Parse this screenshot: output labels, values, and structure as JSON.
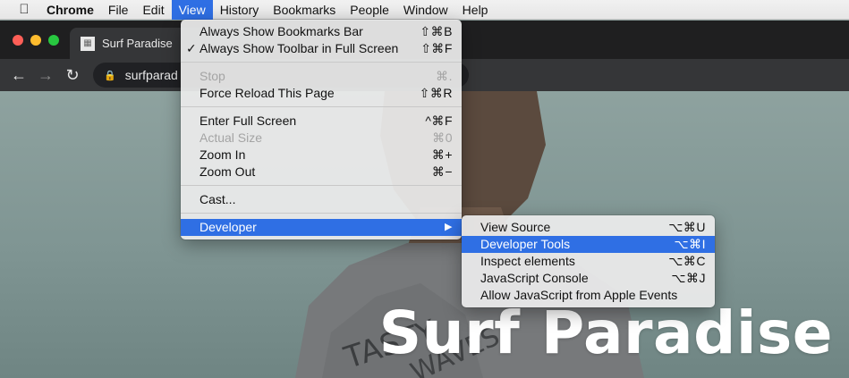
{
  "menubar": {
    "app_name": "Chrome",
    "items": [
      "File",
      "Edit",
      "View",
      "History",
      "Bookmarks",
      "People",
      "Window",
      "Help"
    ],
    "active": "View"
  },
  "browser": {
    "tab_title": "Surf Paradise",
    "url": "surfparad"
  },
  "view_menu": {
    "always_show_bookmarks_bar": {
      "label": "Always Show Bookmarks Bar",
      "shortcut": "⇧⌘B"
    },
    "always_show_toolbar": {
      "label": "Always Show Toolbar in Full Screen",
      "shortcut": "⇧⌘F",
      "checked": true
    },
    "stop": {
      "label": "Stop",
      "shortcut": "⌘.",
      "enabled": false
    },
    "force_reload": {
      "label": "Force Reload This Page",
      "shortcut": "⇧⌘R"
    },
    "enter_full_screen": {
      "label": "Enter Full Screen",
      "shortcut": "^⌘F"
    },
    "actual_size": {
      "label": "Actual Size",
      "shortcut": "⌘0",
      "enabled": false
    },
    "zoom_in": {
      "label": "Zoom In",
      "shortcut": "⌘+"
    },
    "zoom_out": {
      "label": "Zoom Out",
      "shortcut": "⌘−"
    },
    "cast": {
      "label": "Cast..."
    },
    "developer": {
      "label": "Developer",
      "submenu_arrow": "▶"
    }
  },
  "developer_menu": {
    "view_source": {
      "label": "View Source",
      "shortcut": "⌥⌘U"
    },
    "developer_tools": {
      "label": "Developer Tools",
      "shortcut": "⌥⌘I"
    },
    "inspect_elements": {
      "label": "Inspect elements",
      "shortcut": "⌥⌘C"
    },
    "javascript_console": {
      "label": "JavaScript Console",
      "shortcut": "⌥⌘J"
    },
    "allow_js_apple_events": {
      "label": "Allow JavaScript from Apple Events"
    }
  },
  "page": {
    "hero_title": "Surf Paradise"
  },
  "colors": {
    "highlight": "#2f6fe4",
    "menubar_bg": "#ececec",
    "chrome_dark": "#353638"
  }
}
